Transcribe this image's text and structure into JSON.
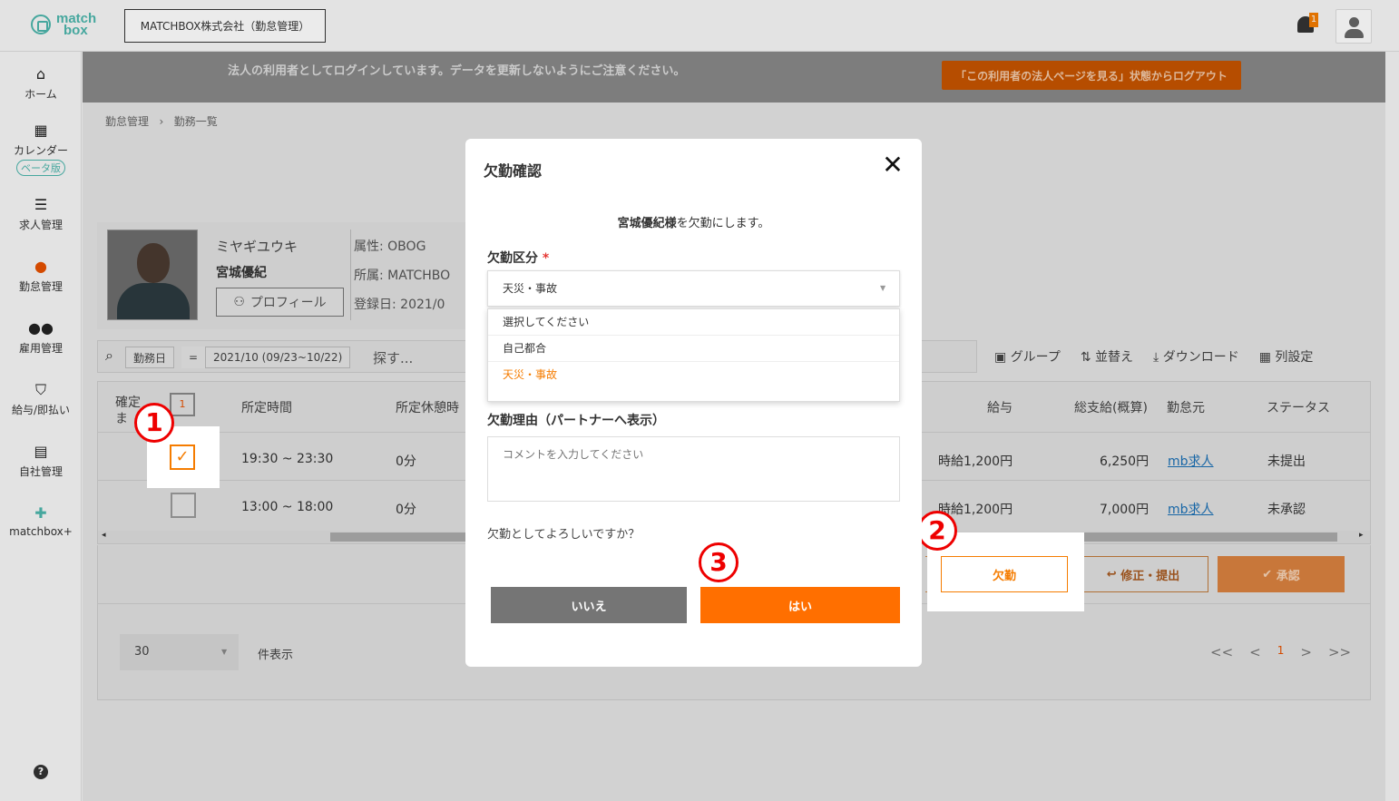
{
  "header": {
    "logo_text_1": "match",
    "logo_text_2": "box",
    "company": "MATCHBOX株式会社（勤怠管理）",
    "notification_count": "1"
  },
  "sidebar": {
    "items": [
      {
        "label": "ホーム",
        "icon": "home-icon"
      },
      {
        "label": "カレンダー",
        "icon": "calendar-icon",
        "badge": "ベータ版"
      },
      {
        "label": "求人管理",
        "icon": "list-icon"
      },
      {
        "label": "勤怠管理",
        "icon": "attendance-icon"
      },
      {
        "label": "雇用管理",
        "icon": "users-icon"
      },
      {
        "label": "給与/即払い",
        "icon": "payment-icon"
      },
      {
        "label": "自社管理",
        "icon": "building-icon"
      },
      {
        "label": "matchbox+",
        "icon": "plus-icon"
      }
    ],
    "help": "?"
  },
  "banner": {
    "message": "法人の利用者としてログインしています。データを更新しないようにご注意ください。",
    "logout_button": "「この利用者の法人ページを見る」状態からログアウト"
  },
  "breadcrumb": {
    "level1": "勤怠管理",
    "separator": "›",
    "level2": "勤務一覧"
  },
  "profile": {
    "kana": "ミヤギユウキ",
    "name": "宮城優紀",
    "profile_button": "プロフィール",
    "attribute": "属性: OBOG",
    "affiliation": "所属: MATCHBO",
    "registered": "登録日: 2021/0"
  },
  "filter": {
    "field": "勤務日",
    "operator": "=",
    "range": "2021/10 (09/23~10/22)",
    "search_placeholder": "探す..."
  },
  "toolbar": {
    "group": "グループ",
    "sort": "並替え",
    "download": "ダウンロード",
    "columns": "列設定"
  },
  "table": {
    "headers": {
      "confirm": "確定",
      "confirm_sub": "ま",
      "selected_count": "1",
      "scheduled_time": "所定時間",
      "scheduled_break": "所定休憩時",
      "wage": "給与",
      "total_pay": "総支給(概算)",
      "employer": "勤怠元",
      "status": "ステータス"
    },
    "rows": [
      {
        "time": "19:30 ~ 23:30",
        "break": "0分",
        "wage": "時給1,200円",
        "total": "6,250円",
        "employer": "mb求人",
        "status": "未提出"
      },
      {
        "time": "13:00 ~ 18:00",
        "break": "0分",
        "wage": "時給1,200円",
        "total": "7,000円",
        "employer": "mb求人",
        "status": "未承認"
      }
    ]
  },
  "actions": {
    "absence": "欠勤",
    "revise_submit": "修正・提出",
    "approve": "承認"
  },
  "pager": {
    "per_page": "30",
    "per_page_label": "件表示",
    "first": "<<",
    "prev": "<",
    "current": "1",
    "next": ">",
    "last": ">>"
  },
  "modal": {
    "title": "欠勤確認",
    "close": "✕",
    "message_name": "宮城優紀様",
    "message_rest": "を欠勤にします。",
    "category_label": "欠勤区分",
    "required_mark": "*",
    "selected_value": "天災・事故",
    "options": [
      "選択してください",
      "自己都合",
      "天災・事故"
    ],
    "reason_label": "欠勤理由（パートナーへ表示）",
    "reason_placeholder": "コメントを入力してください",
    "confirm_question": "欠勤としてよろしいですか？",
    "no_button": "いいえ",
    "yes_button": "はい"
  },
  "annotations": {
    "step1": "1",
    "step2": "2",
    "step3": "3"
  },
  "colors": {
    "accent": "#ff6f00",
    "brand": "#4db6ac",
    "required": "#e53935",
    "annotation": "#ee0000"
  }
}
